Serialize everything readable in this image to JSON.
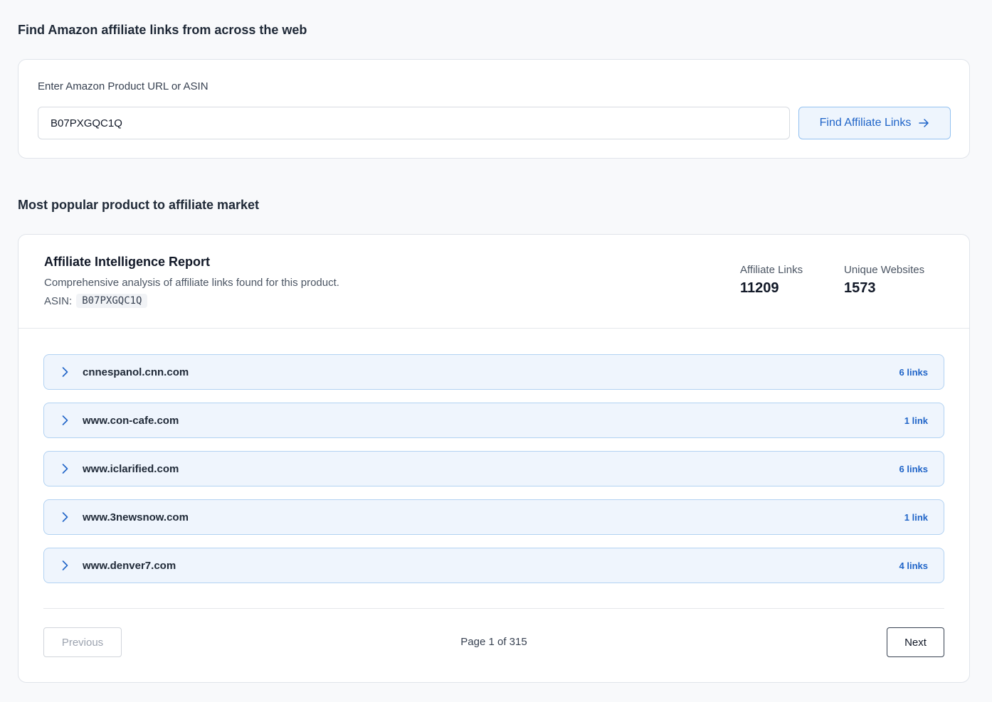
{
  "search": {
    "heading": "Find Amazon affiliate links from across the web",
    "label": "Enter Amazon Product URL or ASIN",
    "input_value": "B07PXGQC1Q",
    "button_label": "Find Affiliate Links",
    "button_icon": "arrow-right-icon"
  },
  "popular": {
    "heading": "Most popular product to affiliate market"
  },
  "report": {
    "title": "Affiliate Intelligence Report",
    "description": "Comprehensive analysis of affiliate links found for this product.",
    "asin_label": "ASIN:",
    "asin": "B07PXGQC1Q",
    "stats": {
      "affiliate_links_label": "Affiliate Links",
      "affiliate_links_value": "11209",
      "unique_websites_label": "Unique Websites",
      "unique_websites_value": "1573"
    },
    "domains": [
      {
        "domain": "cnnespanol.cnn.com",
        "count": "6 links"
      },
      {
        "domain": "www.con-cafe.com",
        "count": "1 link"
      },
      {
        "domain": "www.iclarified.com",
        "count": "6 links"
      },
      {
        "domain": "www.3newsnow.com",
        "count": "1 link"
      },
      {
        "domain": "www.denver7.com",
        "count": "4 links"
      }
    ]
  },
  "pagination": {
    "previous_label": "Previous",
    "page_info": "Page 1 of 315",
    "next_label": "Next"
  },
  "colors": {
    "accent": "#1f64c8",
    "row_bg": "#eff5fd",
    "row_border": "#b2d2f2",
    "page_bg": "#f8f9fb"
  }
}
